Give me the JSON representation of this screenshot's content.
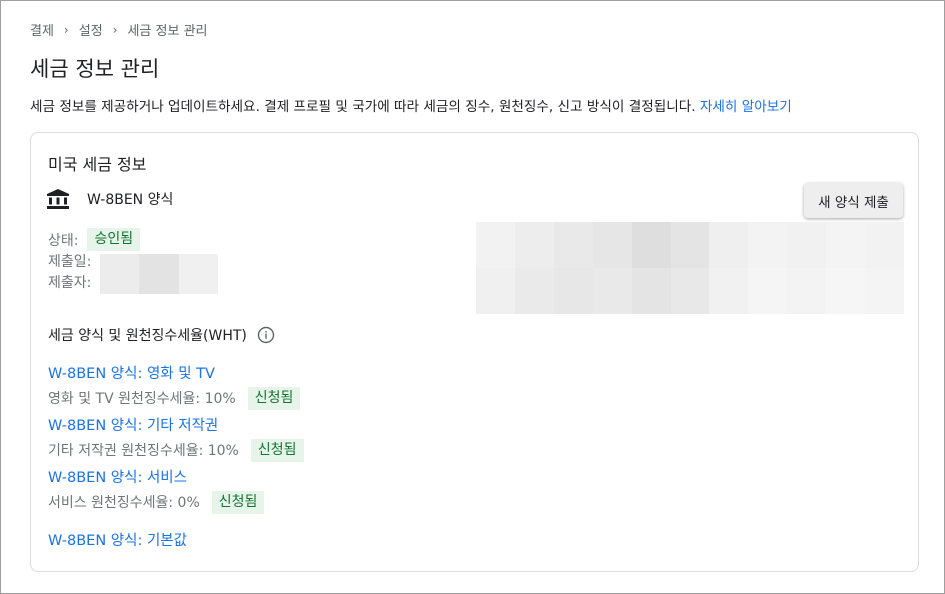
{
  "breadcrumb": [
    "결제",
    "설정",
    "세금 정보 관리"
  ],
  "page": {
    "title": "세금 정보 관리",
    "intro": "세금 정보를 제공하거나 업데이트하세요. 결제 프로필 및 국가에 따라 세금의 징수, 원천징수, 신고 방식이 결정됩니다.",
    "learn_more": "자세히 알아보기"
  },
  "card": {
    "title": "미국 세금 정보",
    "form_name": "W-8BEN 양식",
    "new_form_button": "새 양식 제출",
    "status_label": "상태:",
    "status_value": "승인됨",
    "submitted_date_label": "제출일:",
    "submitter_label": "제출자:",
    "wht_title": "세금 양식 및 원천징수세율(WHT)",
    "wht_items": [
      {
        "link": "W-8BEN 양식: 영화 및 TV",
        "rate": "영화 및 TV 원천징수세율: 10%",
        "badge": "신청됨"
      },
      {
        "link": "W-8BEN 양식: 기타 저작권",
        "rate": "기타 저작권 원천징수세율: 10%",
        "badge": "신청됨"
      },
      {
        "link": "W-8BEN 양식: 서비스",
        "rate": "서비스 원천징수세율: 0%",
        "badge": "신청됨"
      }
    ],
    "default_link": "W-8BEN 양식: 기본값"
  },
  "colors": {
    "link": "#1a73e8",
    "badge_bg": "#e6f4ea",
    "badge_text": "#137333"
  }
}
